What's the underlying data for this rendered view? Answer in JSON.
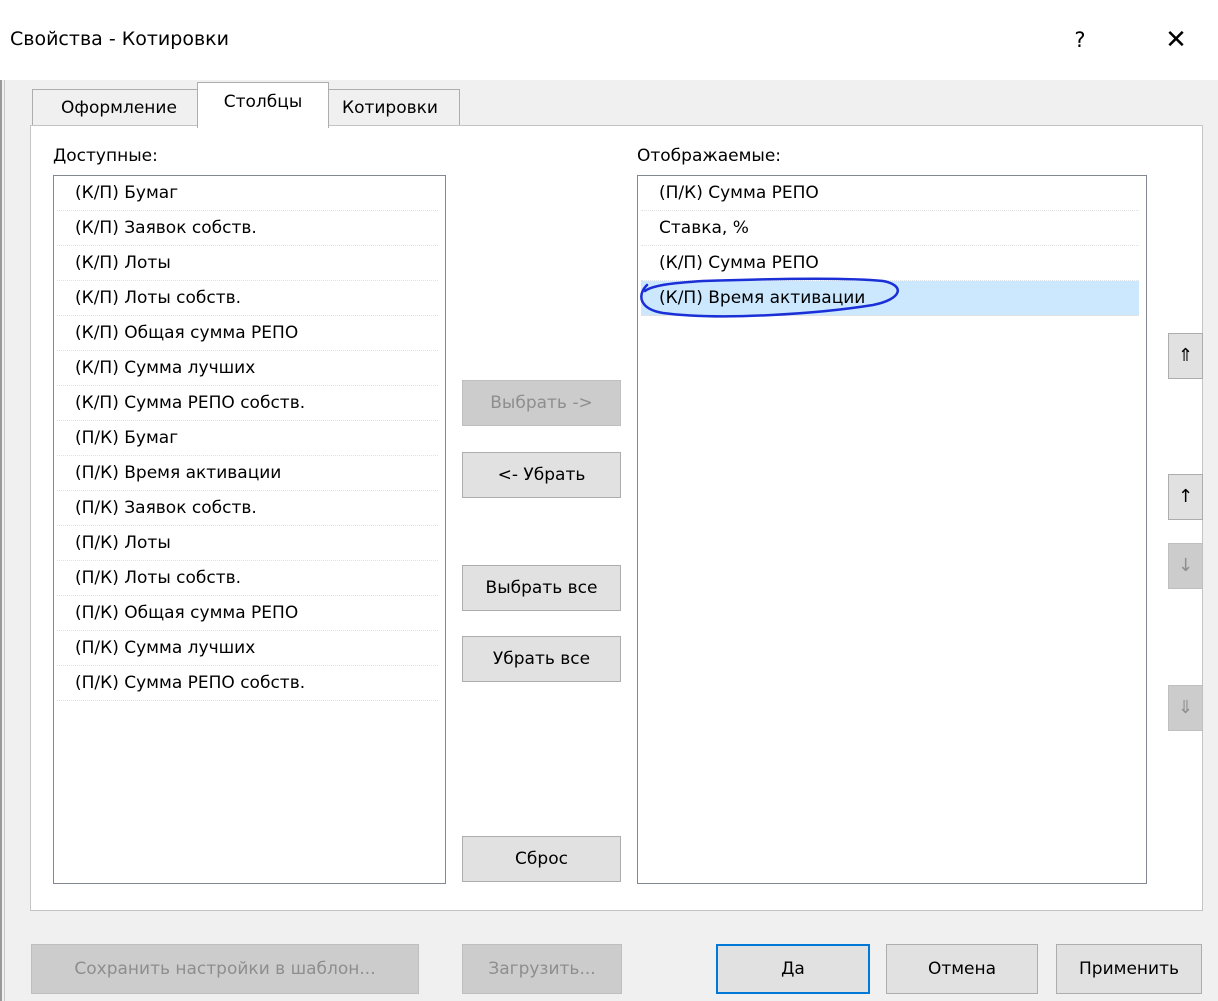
{
  "window": {
    "title": "Свойства - Котировки",
    "help_label": "?",
    "close_label": "✕"
  },
  "tabs": [
    {
      "label": "Оформление",
      "active": false
    },
    {
      "label": "Столбцы",
      "active": true
    },
    {
      "label": "Котировки",
      "active": false
    }
  ],
  "available": {
    "label": "Доступные:",
    "items": [
      "(К/П) Бумаг",
      "(К/П) Заявок собств.",
      "(К/П) Лоты",
      "(К/П) Лоты собств.",
      "(К/П) Общая сумма РЕПО",
      "(К/П) Сумма лучших",
      "(К/П) Сумма РЕПО собств.",
      "(П/К) Бумаг",
      "(П/К) Время активации",
      "(П/К) Заявок собств.",
      "(П/К) Лоты",
      "(П/К) Лоты собств.",
      "(П/К) Общая сумма РЕПО",
      "(П/К) Сумма лучших",
      "(П/К) Сумма РЕПО собств."
    ]
  },
  "displayed": {
    "label": "Отображаемые:",
    "items": [
      "(П/К) Сумма РЕПО",
      "Ставка, %",
      "(К/П) Сумма РЕПО",
      "(К/П) Время активации"
    ],
    "selected_index": 3
  },
  "middle_buttons": {
    "select": "Выбрать ->",
    "remove": "<- Убрать",
    "select_all": "Выбрать все",
    "remove_all": "Убрать все",
    "reset": "Сброс"
  },
  "order_buttons": {
    "top": "⇑",
    "up": "↑",
    "down": "↓",
    "bottom": "⇓"
  },
  "bottom_buttons": {
    "save_template": "Сохранить настройки в шаблон...",
    "load": "Загрузить...",
    "ok": "Да",
    "cancel": "Отмена",
    "apply": "Применить"
  },
  "colors": {
    "selection": "#cce8ff",
    "annotation": "#1a2fd6",
    "default_button_border": "#0078d7"
  }
}
